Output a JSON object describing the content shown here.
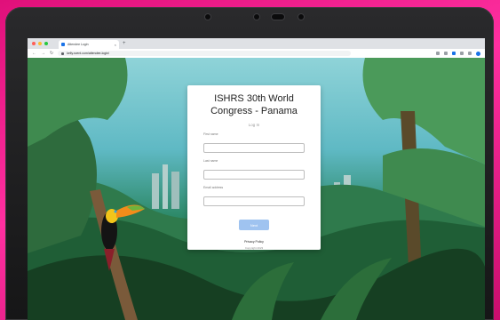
{
  "browser": {
    "tab_title": "Attendee Login",
    "tab_close": "×",
    "new_tab": "+",
    "url": "kelly.cvent.com/attendee-login/",
    "nav": {
      "back": "←",
      "forward": "→",
      "reload": "↻"
    }
  },
  "login": {
    "title": "ISHRS 30th World Congress - Panama",
    "subtitle": "Log In",
    "fields": [
      {
        "label": "First name",
        "value": "",
        "placeholder": ""
      },
      {
        "label": "Last name",
        "value": "",
        "placeholder": ""
      },
      {
        "label": "Email address",
        "value": "",
        "placeholder": ""
      }
    ],
    "next_label": "Next",
    "privacy_label": "Privacy Policy",
    "copyright": "Copyright 2023"
  },
  "colors": {
    "accent": "#9fc3f0",
    "background_pink": "#e0107a",
    "window_dot_red": "#ff5f57",
    "window_dot_yellow": "#febc2e",
    "window_dot_green": "#28c840"
  },
  "icons": [
    "camera-icon",
    "lock-icon",
    "profile-icon",
    "extension-icon",
    "toucan-illustration"
  ]
}
